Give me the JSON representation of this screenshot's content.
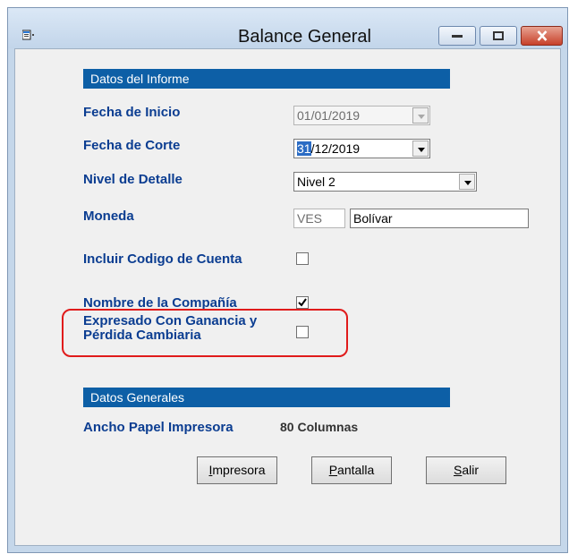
{
  "window": {
    "title": "Balance General",
    "controls": {
      "minimize": "minimize",
      "maximize": "maximize",
      "close": "close"
    }
  },
  "report_section": {
    "header": "Datos del Informe",
    "start_date": {
      "label": "Fecha de Inicio",
      "value": "01/01/2019"
    },
    "cutoff_date": {
      "label": "Fecha de Corte",
      "value_selected": "31",
      "value_rest": "/12/2019"
    },
    "detail_level": {
      "label": "Nivel de Detalle",
      "value": "Nivel 2"
    },
    "currency": {
      "label": "Moneda",
      "code": "VES",
      "name": "Bolívar"
    },
    "include_account_code": {
      "label": "Incluir Codigo de Cuenta",
      "checked": false
    },
    "company_name": {
      "label": "Nombre de la Compañía",
      "checked": true
    },
    "exchange_gain_loss": {
      "label_line1": "Expresado Con Ganancia y",
      "label_line2": "Pérdida Cambiaria",
      "checked": false
    }
  },
  "general_section": {
    "header": "Datos Generales",
    "printer_width": {
      "label": "Ancho Papel Impresora",
      "value": "80 Columnas"
    }
  },
  "buttons": {
    "printer": {
      "hotkey": "I",
      "rest": "mpresora"
    },
    "screen": {
      "hotkey": "P",
      "rest": "antalla"
    },
    "exit": {
      "hotkey": "S",
      "rest": "alir"
    }
  },
  "colors": {
    "section_bar": "#0d5fa6",
    "label": "#0b3d91",
    "highlight": "#e01b1b"
  }
}
